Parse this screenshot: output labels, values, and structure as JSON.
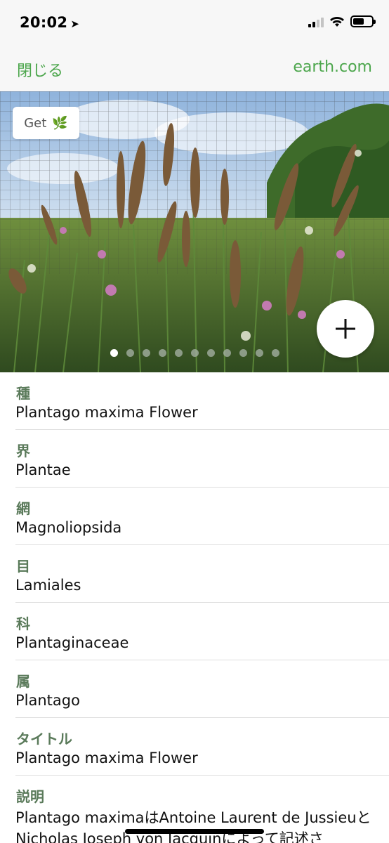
{
  "status_bar": {
    "time": "20:02",
    "location_arrow": "➤",
    "battery_level": 0.6
  },
  "nav": {
    "close_label": "閉じる",
    "site_label": "earth.com"
  },
  "photo": {
    "get_label": "Get",
    "get_icon": "🌿",
    "page_count": 11,
    "active_page": 0,
    "add_icon": "plus-icon"
  },
  "info": [
    {
      "label": "種",
      "value": "Plantago maxima Flower"
    },
    {
      "label": "界",
      "value": "Plantae"
    },
    {
      "label": "網",
      "value": "Magnoliopsida"
    },
    {
      "label": "目",
      "value": "Lamiales"
    },
    {
      "label": "科",
      "value": "Plantaginaceae"
    },
    {
      "label": "属",
      "value": "Plantago"
    },
    {
      "label": "タイトル",
      "value": "Plantago maxima Flower"
    }
  ],
  "description": {
    "label": "説明",
    "text": "Plantago maximaはAntoine Laurent de JussieuとNicholas Joseph von Jacquinによって記述さ"
  },
  "colors": {
    "accent": "#4ca64c",
    "label": "#5a7a5a"
  }
}
